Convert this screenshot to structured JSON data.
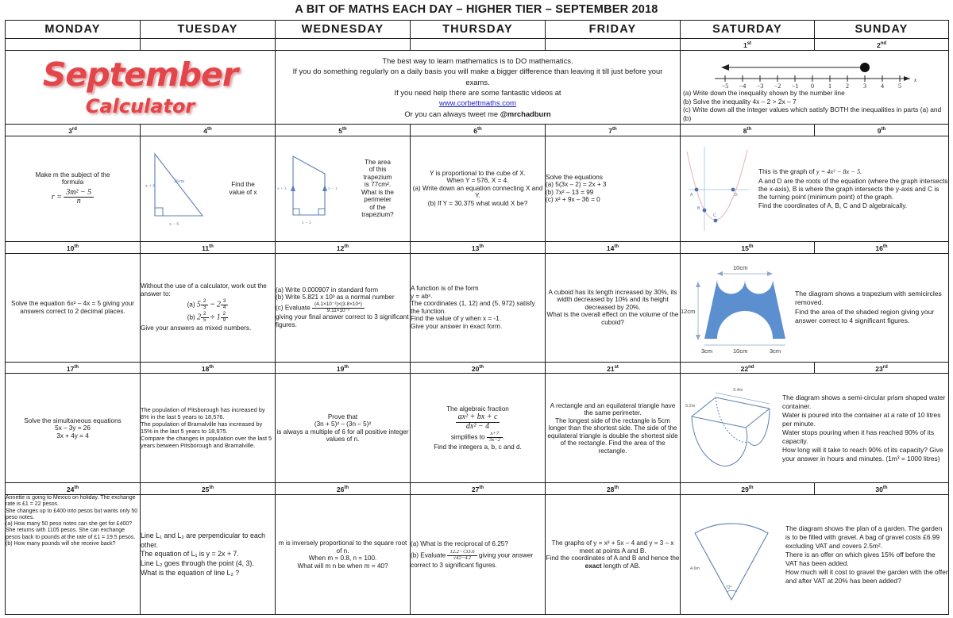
{
  "title": "A BIT OF MATHS EACH DAY – HIGHER TIER – SEPTEMBER 2018",
  "weekdays": [
    "MONDAY",
    "TUESDAY",
    "WEDNESDAY",
    "THURSDAY",
    "FRIDAY",
    "SATURDAY",
    "SUNDAY"
  ],
  "branding": {
    "month": "September",
    "subtitle": "Calculator",
    "accent_color": "#e2454a"
  },
  "intro": {
    "line1": "The best way to learn mathematics is to DO mathematics.",
    "line2": "If you do something regularly on a daily basis you will make a bigger difference than leaving it till just before your exams.",
    "line3": "If you need help there are some fantastic videos at",
    "link": "www.corbettmaths.com",
    "line4_prefix": "Or you can always tweet me ",
    "twitter": "@mrchadburn"
  },
  "day_numbers": {
    "d1": "1",
    "d1s": "st",
    "d2": "2",
    "d2s": "nd",
    "d3": "3",
    "d3s": "rd",
    "d4": "4",
    "d4s": "th",
    "d5": "5",
    "d5s": "th",
    "d6": "6",
    "d6s": "th",
    "d7": "7",
    "d7s": "th",
    "d8": "8",
    "d8s": "th",
    "d9": "9",
    "d9s": "th",
    "d10": "10",
    "d10s": "th",
    "d11": "11",
    "d11s": "th",
    "d12": "12",
    "d12s": "th",
    "d13": "13",
    "d13s": "th",
    "d14": "14",
    "d14s": "th",
    "d15": "15",
    "d15s": "th",
    "d16": "16",
    "d16s": "th",
    "d17": "17",
    "d17s": "th",
    "d18": "18",
    "d18s": "th",
    "d19": "19",
    "d19s": "th",
    "d20": "20",
    "d20s": "th",
    "d21": "21",
    "d21s": "st",
    "d22": "22",
    "d22s": "nd",
    "d23": "23",
    "d23s": "rd",
    "d24": "24",
    "d24s": "th",
    "d25": "25",
    "d25s": "th",
    "d26": "26",
    "d26s": "th",
    "d27": "27",
    "d27s": "th",
    "d28": "28",
    "d28s": "th",
    "d29": "29",
    "d29s": "th",
    "d30": "30",
    "d30s": "th"
  },
  "q1": {
    "a": "(a) Write down the inequality shown by the number line",
    "b": "(b) Solve the inequality 4x – 2 > 2x – 7",
    "c": "(c) Write down all the integer values which satisfy BOTH the inequalities in parts (a) and (b)",
    "number_line": {
      "ticks": [
        "−5",
        "−4",
        "−3",
        "−2",
        "−1",
        "0",
        "1",
        "2",
        "3",
        "4",
        "5"
      ],
      "axis_label": "x",
      "point": "3",
      "direction": "left"
    }
  },
  "q3": {
    "line1": "Make m the subject of the",
    "line2": "formula",
    "formula_lhs": "r =",
    "formula_num": "3m² − 5",
    "formula_den": "n"
  },
  "q4": {
    "text": "Find the\nvalue of x",
    "labels": {
      "left": "x + 8",
      "hyp": "26cm",
      "base": "x − 6"
    }
  },
  "q5": {
    "text": "The area\nof this\ntrapezium\nis 77cm².\nWhat is the\nperimeter\nof the\ntrapezium?",
    "labels": {
      "left": "x + 3",
      "right": "x − 1",
      "base": "x − 3"
    }
  },
  "q6": {
    "line1": "Y is proportional to the cube of X.",
    "line2": "When Y = 576, X = 4.",
    "line3": "(a) Write down an equation connecting X and Y.",
    "line4": "(b) If Y = 30.375 what would X be?"
  },
  "q7": {
    "intro": "Solve the equations",
    "a": "(a) 5(3x – 2) = 2x + 3",
    "b": "(b) 7x² – 13 = 99",
    "c": "(c) x² + 9x – 36 = 0"
  },
  "q8": {
    "line1_prefix": "This is the graph of ",
    "equation": "y = 4x² − 8x − 5.",
    "line2": "A and D are the roots of the equation (where the graph intersects the x-axis), B is where the graph intersects the y-axis and C is the turning point (minimum point) of the graph.",
    "line3": "Find the coordinates of A, B, C and D algebraically.",
    "point_labels": [
      "A",
      "B",
      "C",
      "D"
    ]
  },
  "q10": {
    "text": "Solve the equation 6x² – 4x = 5 giving your answers correct to 2 decimal places."
  },
  "q11": {
    "intro": "Without the use of a calculator, work out the answer to:",
    "a_label": "(a)",
    "a_w1": "5",
    "a_n1": "2",
    "a_d1": "3",
    "a_op": "−",
    "a_w2": "2",
    "a_n2": "3",
    "a_d2": "4",
    "b_label": "(b)",
    "b_w1": "2",
    "b_n1": "2",
    "b_d1": "5",
    "b_op": "÷",
    "b_w2": "1",
    "b_n2": "2",
    "b_d2": "9",
    "outro": "Give your answers as mixed numbers."
  },
  "q12": {
    "a": "(a) Write 0.000907 in standard form",
    "b": "(b) Write 5.821 x 10³ as a normal number",
    "c_label": "(c) Evaluate",
    "c_num": "(4.1×10⁻²)×(3.8×10⁴)",
    "c_den": "9.11×10⁻²",
    "outro": "giving your final answer correct to 3 significant figures."
  },
  "q13": {
    "line1": "A function is of the form",
    "line2": "y = abˣ.",
    "line3": "The coordinates (1, 12) and (5, 972) satisfy the function.",
    "line4": "Find the value of y when x = -1.",
    "line5": "Give your answer in exact form."
  },
  "q14": {
    "text": "A cuboid has its length increased by 30%, its width decreased by 10% and its height decreased by 20%.\nWhat is the overall effect on the volume of the cuboid?"
  },
  "q15": {
    "labels": {
      "top": "10cm",
      "height": "12cm",
      "base_left": "3cm",
      "base_mid": "10cm",
      "base_right": "3cm"
    }
  },
  "q16": {
    "text": "The diagram shows a trapezium with semicircles removed.\nFind the area of the shaded region giving your answer correct to 4 significant figures."
  },
  "q17": {
    "intro": "Solve the simultaneous equations",
    "eq1": "5x – 3y = 26",
    "eq2": "3x + 4y = 4"
  },
  "q18": {
    "p1": "The population of Pitsborough has increased by 8% in the last 5 years to 18,576.",
    "p2": "The population of Bramalville has increased by 15% in the last 5 years to 18,975.",
    "p3": "Compare the changes in population over the last 5 years between Pitsborough and Bramalville."
  },
  "q19": {
    "line1": "Prove that",
    "line2": "(3n + 5)² – (3n – 5)²",
    "line3": "is always a multiple of 6 for all positive integer values of n."
  },
  "q20": {
    "line1": "The algebraic fraction",
    "num": "ax² + bx + c",
    "den": "dx² − 4",
    "simplifies": "simplifies to",
    "s_num": "x+7",
    "s_den": "3x−2",
    "line3": "Find the integers a, b, c and d."
  },
  "q21": {
    "text": "A rectangle and an equilateral triangle have the same perimeter.\nThe longest side of the rectangle is 5cm longer than the shortest side.  The side of the equilateral triangle is double the shortest side of the rectangle.  Find the area of the rectangle."
  },
  "q22": {
    "labels": {
      "width": "3.4m",
      "length": "5.2m"
    }
  },
  "q23": {
    "text": "The diagram shows a semi-circular prism shaped water container.\nWater is poured into the container at a rate of 10 litres per minute.\nWater stops pouring when it has reached 90% of its capacity.\nHow long will it take to reach 90% of its capacity?  Give your answer in hours and minutes.  (1m³ = 1000 litres)"
  },
  "q24": {
    "p1": "Annette is going to Mexico on holiday.  The exchange rate is £1 = 22 pesos.",
    "p2": "She changes up to £400 into pesos but wants only 50 peso notes.",
    "p3": "(a) How many 50 peso notes can she get for £400?",
    "p4": "She returns with 1105 pesos.  She can exchange pesos back to pounds at the rate of £1 = 19.5 pesos.",
    "p5": "(b) How many pounds will she receive back?"
  },
  "q25": {
    "l1": "Line L₁ and L₂ are perpendicular to each other.",
    "l2": "The equation of L₁ is y = 2x + 7.",
    "l3": "Line L₂ goes through the point (4, 3).",
    "l4": "What is the equation of line L₂ ?"
  },
  "q26": {
    "text": "m is inversely proportional to the square root of n.\nWhen m = 0.8, n = 100.\nWhat will m n be when m = 40?"
  },
  "q27": {
    "a": "(a) What is the reciprocal of 6.25?",
    "b_label": "(b) Evaluate",
    "b_num": "12.2−√33.6",
    "b_den": "√42−4.1",
    "b_tail": "giving your answer correct to 3 significant figures."
  },
  "q28": {
    "line1": "The graphs of y = x² + 5x – 4 and y = 3 – x meet at points A and B.",
    "line2_a": "Find the coordinates of A and B and hence the ",
    "line2_bold": "exact",
    "line2_b": " length of AB."
  },
  "q29": {
    "labels": {
      "radius": "4.6m",
      "angle": "72°"
    }
  },
  "q30": {
    "text": "The diagram shows the plan of a garden.  The garden is to be filled with gravel.  A bag of gravel costs £6.99 excluding VAT and covers 2.5m².\nThere is an offer on which gives 15% off before the VAT has been added.\nHow much will it cost to gravel the garden with the offer and after VAT at 20% has been added?"
  }
}
